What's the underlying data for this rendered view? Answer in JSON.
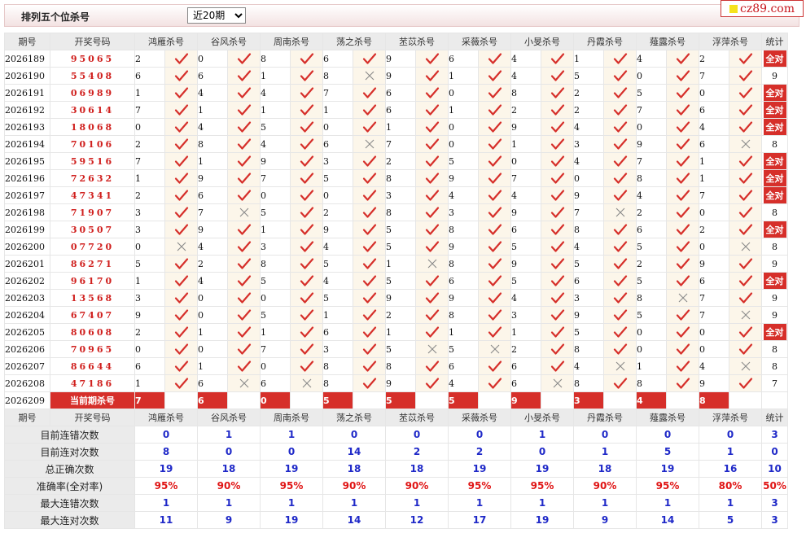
{
  "header": {
    "title": "排列五个位杀号",
    "period_selected": "近20期",
    "period_options": [
      "近20期"
    ]
  },
  "logo": {
    "text": "cz89.com"
  },
  "columns": {
    "issue": "期号",
    "winning": "开奖号码",
    "experts": [
      "鸿雁杀号",
      "谷风杀号",
      "周南杀号",
      "荡之杀号",
      "苤苡杀号",
      "采薇杀号",
      "小旻杀号",
      "丹霞杀号",
      "薤露杀号",
      "浮萍杀号"
    ],
    "stat": "统计"
  },
  "rows": [
    {
      "issue": "2026189",
      "win": "95065",
      "kills": [
        2,
        0,
        8,
        6,
        9,
        6,
        4,
        1,
        4,
        2
      ],
      "hits": [
        1,
        1,
        1,
        1,
        1,
        1,
        1,
        1,
        1,
        1
      ],
      "stat": "全对"
    },
    {
      "issue": "2026190",
      "win": "55408",
      "kills": [
        6,
        6,
        1,
        8,
        9,
        1,
        4,
        5,
        0,
        7
      ],
      "hits": [
        1,
        1,
        1,
        0,
        1,
        1,
        1,
        1,
        1,
        1
      ],
      "stat": "9"
    },
    {
      "issue": "2026191",
      "win": "06989",
      "kills": [
        1,
        4,
        4,
        7,
        6,
        0,
        8,
        2,
        5,
        0
      ],
      "hits": [
        1,
        1,
        1,
        1,
        1,
        1,
        1,
        1,
        1,
        1
      ],
      "stat": "全对"
    },
    {
      "issue": "2026192",
      "win": "30614",
      "kills": [
        7,
        1,
        1,
        1,
        6,
        1,
        2,
        2,
        7,
        6
      ],
      "hits": [
        1,
        1,
        1,
        1,
        1,
        1,
        1,
        1,
        1,
        1
      ],
      "stat": "全对"
    },
    {
      "issue": "2026193",
      "win": "18068",
      "kills": [
        0,
        4,
        5,
        0,
        1,
        0,
        9,
        4,
        0,
        4
      ],
      "hits": [
        1,
        1,
        1,
        1,
        1,
        1,
        1,
        1,
        1,
        1
      ],
      "stat": "全对"
    },
    {
      "issue": "2026194",
      "win": "70106",
      "kills": [
        2,
        8,
        4,
        6,
        7,
        0,
        1,
        3,
        9,
        6
      ],
      "hits": [
        1,
        1,
        1,
        0,
        1,
        1,
        1,
        1,
        1,
        0
      ],
      "stat": "8"
    },
    {
      "issue": "2026195",
      "win": "59516",
      "kills": [
        7,
        1,
        9,
        3,
        2,
        5,
        0,
        4,
        7,
        1
      ],
      "hits": [
        1,
        1,
        1,
        1,
        1,
        1,
        1,
        1,
        1,
        1
      ],
      "stat": "全对"
    },
    {
      "issue": "2026196",
      "win": "72632",
      "kills": [
        1,
        9,
        7,
        5,
        8,
        9,
        7,
        0,
        8,
        1
      ],
      "hits": [
        1,
        1,
        1,
        1,
        1,
        1,
        1,
        1,
        1,
        1
      ],
      "stat": "全对"
    },
    {
      "issue": "2026197",
      "win": "47341",
      "kills": [
        2,
        6,
        0,
        0,
        3,
        4,
        4,
        9,
        4,
        7
      ],
      "hits": [
        1,
        1,
        1,
        1,
        1,
        1,
        1,
        1,
        1,
        1
      ],
      "stat": "全对"
    },
    {
      "issue": "2026198",
      "win": "71907",
      "kills": [
        3,
        7,
        5,
        2,
        8,
        3,
        9,
        7,
        2,
        0
      ],
      "hits": [
        1,
        0,
        1,
        1,
        1,
        1,
        1,
        0,
        1,
        1
      ],
      "stat": "8"
    },
    {
      "issue": "2026199",
      "win": "30507",
      "kills": [
        3,
        9,
        1,
        9,
        5,
        8,
        6,
        8,
        6,
        2
      ],
      "hits": [
        1,
        1,
        1,
        1,
        1,
        1,
        1,
        1,
        1,
        1
      ],
      "stat": "全对"
    },
    {
      "issue": "2026200",
      "win": "07720",
      "kills": [
        0,
        4,
        3,
        4,
        5,
        9,
        5,
        4,
        5,
        0
      ],
      "hits": [
        0,
        1,
        1,
        1,
        1,
        1,
        1,
        1,
        1,
        0
      ],
      "stat": "8"
    },
    {
      "issue": "2026201",
      "win": "86271",
      "kills": [
        5,
        2,
        8,
        5,
        1,
        8,
        9,
        5,
        2,
        9
      ],
      "hits": [
        1,
        1,
        1,
        1,
        0,
        1,
        1,
        1,
        1,
        1
      ],
      "stat": "9"
    },
    {
      "issue": "2026202",
      "win": "96170",
      "kills": [
        1,
        4,
        5,
        4,
        5,
        6,
        5,
        6,
        5,
        6
      ],
      "hits": [
        1,
        1,
        1,
        1,
        1,
        1,
        1,
        1,
        1,
        1
      ],
      "stat": "全对"
    },
    {
      "issue": "2026203",
      "win": "13568",
      "kills": [
        3,
        0,
        0,
        5,
        9,
        9,
        4,
        3,
        8,
        7
      ],
      "hits": [
        1,
        1,
        1,
        1,
        1,
        1,
        1,
        1,
        0,
        1
      ],
      "stat": "9"
    },
    {
      "issue": "2026204",
      "win": "67407",
      "kills": [
        9,
        0,
        5,
        1,
        2,
        8,
        3,
        9,
        5,
        7
      ],
      "hits": [
        1,
        1,
        1,
        1,
        1,
        1,
        1,
        1,
        1,
        0
      ],
      "stat": "9"
    },
    {
      "issue": "2026205",
      "win": "80608",
      "kills": [
        2,
        1,
        1,
        6,
        1,
        1,
        1,
        5,
        0,
        0
      ],
      "hits": [
        1,
        1,
        1,
        1,
        1,
        1,
        1,
        1,
        1,
        1
      ],
      "stat": "全对"
    },
    {
      "issue": "2026206",
      "win": "70965",
      "kills": [
        0,
        0,
        7,
        3,
        5,
        5,
        2,
        8,
        0,
        0
      ],
      "hits": [
        1,
        1,
        1,
        1,
        0,
        0,
        1,
        1,
        1,
        1
      ],
      "stat": "8"
    },
    {
      "issue": "2026207",
      "win": "86644",
      "kills": [
        6,
        1,
        0,
        8,
        8,
        6,
        6,
        4,
        1,
        4
      ],
      "hits": [
        1,
        1,
        1,
        1,
        1,
        1,
        1,
        0,
        1,
        0
      ],
      "stat": "8"
    },
    {
      "issue": "2026208",
      "win": "47186",
      "kills": [
        1,
        6,
        6,
        8,
        9,
        4,
        6,
        8,
        8,
        9
      ],
      "hits": [
        1,
        0,
        0,
        1,
        1,
        1,
        0,
        1,
        1,
        1
      ],
      "stat": "7"
    }
  ],
  "current": {
    "issue": "2026209",
    "label": "当前期杀号",
    "kills": [
      "7",
      "6",
      "0",
      "5",
      "5",
      "5",
      "9",
      "3",
      "4",
      "8"
    ]
  },
  "stats": {
    "rows": [
      {
        "label": "目前连错次数",
        "values": [
          "0",
          "1",
          "1",
          "0",
          "0",
          "0",
          "1",
          "0",
          "0",
          "0"
        ],
        "stat": "3"
      },
      {
        "label": "目前连对次数",
        "values": [
          "8",
          "0",
          "0",
          "14",
          "2",
          "2",
          "0",
          "1",
          "5",
          "1"
        ],
        "stat": "0"
      },
      {
        "label": "总正确次数",
        "values": [
          "19",
          "18",
          "19",
          "18",
          "18",
          "19",
          "19",
          "18",
          "19",
          "16"
        ],
        "stat": "10"
      },
      {
        "label": "准确率(全对率)",
        "values": [
          "95%",
          "90%",
          "95%",
          "90%",
          "90%",
          "95%",
          "95%",
          "90%",
          "95%",
          "80%"
        ],
        "stat": "50%"
      },
      {
        "label": "最大连错次数",
        "values": [
          "1",
          "1",
          "1",
          "1",
          "1",
          "1",
          "1",
          "1",
          "1",
          "1"
        ],
        "stat": "3"
      },
      {
        "label": "最大连对次数",
        "values": [
          "11",
          "9",
          "19",
          "14",
          "12",
          "17",
          "19",
          "9",
          "14",
          "5"
        ],
        "stat": "3"
      }
    ]
  },
  "colors": {
    "red": "#d62f2a",
    "blue": "#1f29c8",
    "cream": "#fcf6ea",
    "header_bg": "#ebebeb"
  },
  "icons": {
    "hit": "check-icon",
    "miss": "cross-icon"
  }
}
